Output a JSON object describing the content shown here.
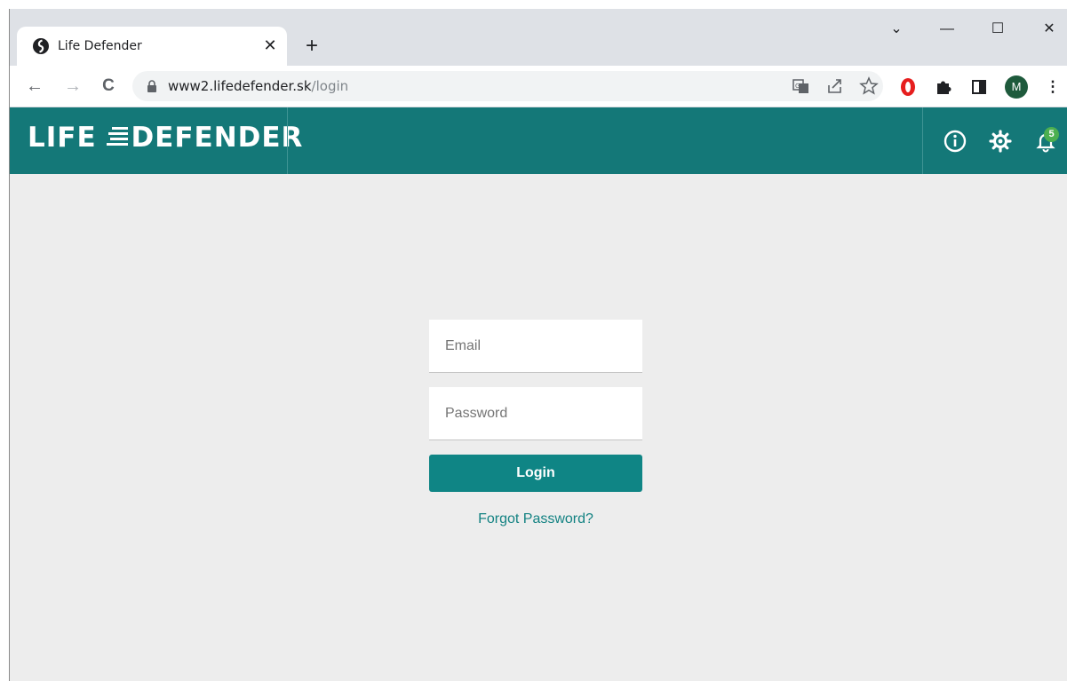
{
  "browser": {
    "tab": {
      "title": "Life Defender",
      "close_glyph": "✕"
    },
    "new_tab_glyph": "+",
    "window_controls": {
      "tab_search": "⌄",
      "minimize": "—",
      "maximize": "☐",
      "close": "✕"
    },
    "nav": {
      "back": "←",
      "forward": "→",
      "reload": "C"
    },
    "address": {
      "host": "www2.lifedefender.sk",
      "path": "/login"
    },
    "omnibox_icons": [
      "translate-icon",
      "share-icon",
      "star-icon"
    ],
    "extensions": [
      "opera-icon",
      "puzzle-icon",
      "side-panel-icon"
    ],
    "profile_initial": "M",
    "menu_glyph": "⋮"
  },
  "app": {
    "logo": {
      "left": "LIFE",
      "right": "DEFENDER"
    },
    "colors": {
      "header": "#147878",
      "accent": "#0f8585",
      "badge": "#4caf50"
    },
    "header_icons": [
      "info-icon",
      "settings-icon",
      "bell-icon"
    ],
    "notifications_count": "5"
  },
  "login": {
    "email_placeholder": "Email",
    "password_placeholder": "Password",
    "login_label": "Login",
    "forgot_label": "Forgot Password?"
  }
}
